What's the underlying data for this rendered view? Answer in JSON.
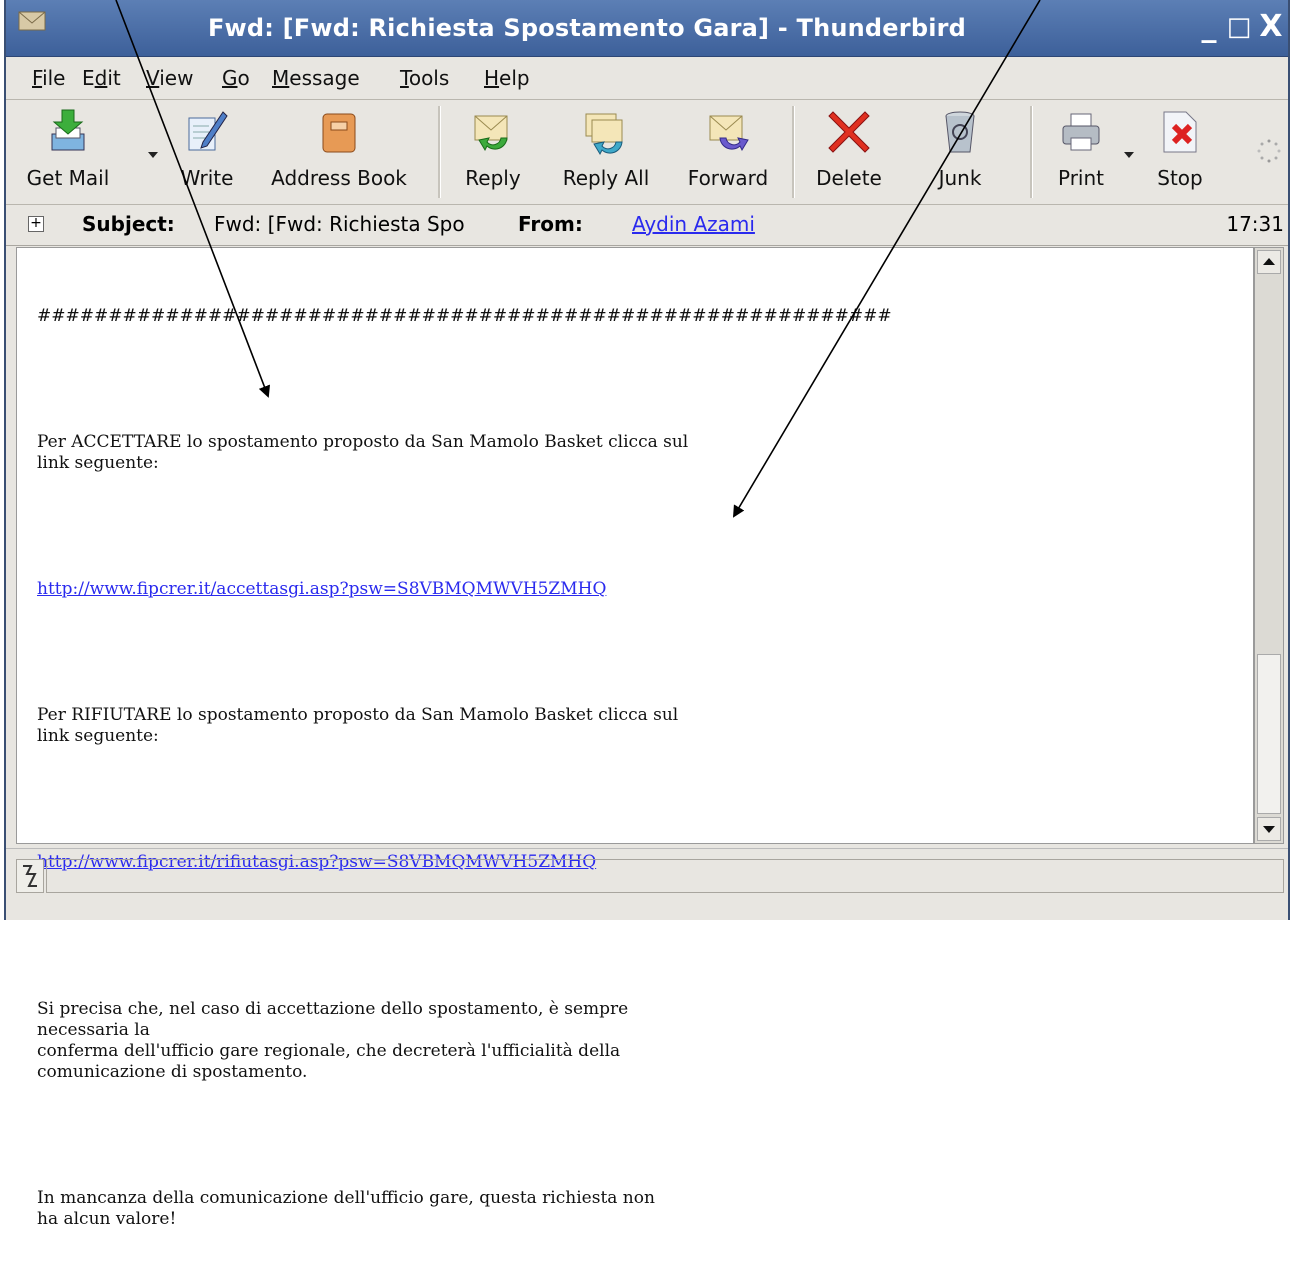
{
  "window": {
    "title": "Fwd: [Fwd: Richiesta Spostamento Gara] - Thunderbird",
    "min": "_",
    "max": "□",
    "close": "X"
  },
  "menu": [
    {
      "pre": "",
      "u": "F",
      "post": "ile"
    },
    {
      "pre": "E",
      "u": "d",
      "post": "it"
    },
    {
      "pre": "",
      "u": "V",
      "post": "iew"
    },
    {
      "pre": "",
      "u": "G",
      "post": "o"
    },
    {
      "pre": "",
      "u": "M",
      "post": "essage"
    },
    {
      "pre": "",
      "u": "T",
      "post": "ools"
    },
    {
      "pre": "",
      "u": "H",
      "post": "elp"
    }
  ],
  "toolbar": {
    "get_mail": "Get Mail",
    "write": "Write",
    "address_book": "Address Book",
    "reply": "Reply",
    "reply_all": "Reply All",
    "forward": "Forward",
    "delete": "Delete",
    "junk": "Junk",
    "print": "Print",
    "stop": "Stop"
  },
  "header": {
    "subject_label": "Subject:",
    "subject_value": "Fwd: [Fwd: Richiesta Spo",
    "from_label": "From:",
    "from_value": "Aydin Azami",
    "time": "17:31"
  },
  "message": {
    "hashes": "############################################################",
    "accept_text": "Per ACCETTARE lo spostamento proposto da San Mamolo Basket clicca sul\nlink seguente:",
    "accept_link": "http://www.fipcrer.it/accettasgi.asp?psw=S8VBMQMWVH5ZMHQ",
    "reject_text": "Per RIFIUTARE lo spostamento proposto da San Mamolo Basket clicca sul\nlink seguente:",
    "reject_link": "http://www.fipcrer.it/rifiutasgi.asp?psw=S8VBMQMWVH5ZMHQ",
    "note": "Si precisa che, nel caso di accettazione dello spostamento, è sempre\nnecessaria la\nconferma dell'ufficio gare regionale, che decreterà l'ufficialità della\ncomunicazione di spostamento.",
    "warning": "In mancanza della comunicazione dell'ufficio gare, questa richiesta non\nha alcun valore!"
  }
}
